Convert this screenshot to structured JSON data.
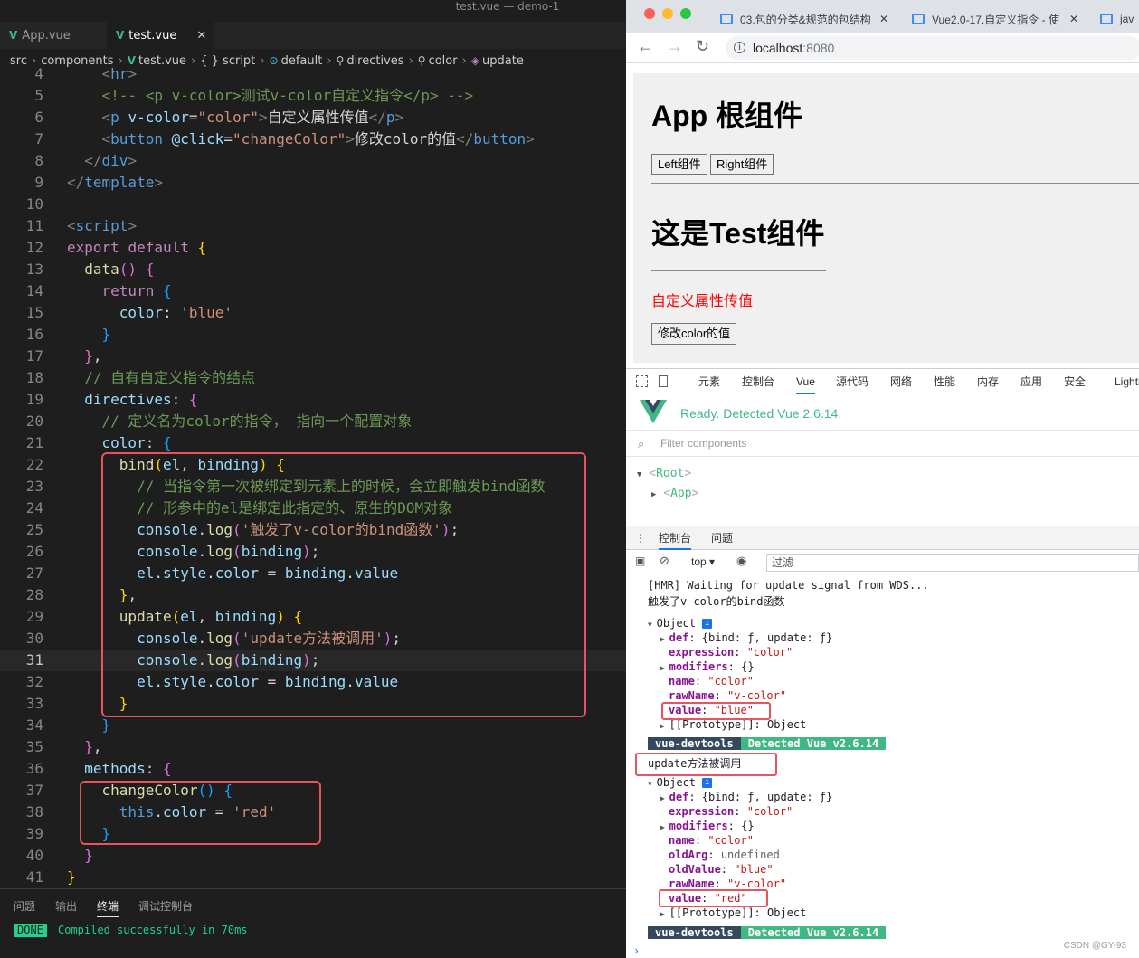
{
  "editor": {
    "window_title": "test.vue — demo-1",
    "tabs": [
      {
        "label": "App.vue",
        "active": false
      },
      {
        "label": "test.vue",
        "active": true
      }
    ],
    "breadcrumb": [
      "src",
      "components",
      "test.vue",
      "{ } script",
      "default",
      "directives",
      "color",
      "update"
    ],
    "current_line": 31,
    "lines": [
      {
        "n": 4,
        "segs": [
          [
            "g",
            "    <"
          ],
          [
            "k",
            "hr"
          ],
          [
            "g",
            ">"
          ]
        ]
      },
      {
        "n": 5,
        "segs": [
          [
            "c",
            "    <!-- <p v-color>测试v-color自定义指令</p> -->"
          ]
        ]
      },
      {
        "n": 6,
        "segs": [
          [
            "g",
            "    <"
          ],
          [
            "k",
            "p"
          ],
          [
            "w",
            " "
          ],
          [
            "a",
            "v-color"
          ],
          [
            "w",
            "="
          ],
          [
            "s",
            "\"color\""
          ],
          [
            "g",
            ">"
          ],
          [
            "w",
            "自定义属性传值"
          ],
          [
            "g",
            "</"
          ],
          [
            "k",
            "p"
          ],
          [
            "g",
            ">"
          ]
        ]
      },
      {
        "n": 7,
        "segs": [
          [
            "g",
            "    <"
          ],
          [
            "k",
            "button"
          ],
          [
            "w",
            " "
          ],
          [
            "a",
            "@click"
          ],
          [
            "w",
            "="
          ],
          [
            "s",
            "\"changeColor\""
          ],
          [
            "g",
            ">"
          ],
          [
            "w",
            "修改color的值"
          ],
          [
            "g",
            "</"
          ],
          [
            "k",
            "button"
          ],
          [
            "g",
            ">"
          ]
        ]
      },
      {
        "n": 8,
        "segs": [
          [
            "g",
            "  </"
          ],
          [
            "k",
            "div"
          ],
          [
            "g",
            ">"
          ]
        ]
      },
      {
        "n": 9,
        "segs": [
          [
            "g",
            "</"
          ],
          [
            "k",
            "template"
          ],
          [
            "g",
            ">"
          ]
        ]
      },
      {
        "n": 10,
        "segs": [
          [
            "w",
            ""
          ]
        ]
      },
      {
        "n": 11,
        "segs": [
          [
            "g",
            "<"
          ],
          [
            "k",
            "script"
          ],
          [
            "g",
            ">"
          ]
        ]
      },
      {
        "n": 12,
        "segs": [
          [
            "pk",
            "export"
          ],
          [
            "w",
            " "
          ],
          [
            "pk",
            "default"
          ],
          [
            "w",
            " "
          ],
          [
            "y",
            "{"
          ]
        ]
      },
      {
        "n": 13,
        "segs": [
          [
            "w",
            "  "
          ],
          [
            "f",
            "data"
          ],
          [
            "m",
            "()"
          ],
          [
            "w",
            " "
          ],
          [
            "m",
            "{"
          ]
        ]
      },
      {
        "n": 14,
        "segs": [
          [
            "w",
            "    "
          ],
          [
            "pk",
            "return"
          ],
          [
            "w",
            " "
          ],
          [
            "b",
            "{"
          ]
        ]
      },
      {
        "n": 15,
        "segs": [
          [
            "w",
            "      "
          ],
          [
            "a",
            "color"
          ],
          [
            "w",
            ": "
          ],
          [
            "s",
            "'blue'"
          ]
        ]
      },
      {
        "n": 16,
        "segs": [
          [
            "w",
            "    "
          ],
          [
            "b",
            "}"
          ]
        ]
      },
      {
        "n": 17,
        "segs": [
          [
            "w",
            "  "
          ],
          [
            "m",
            "}"
          ],
          [
            "w",
            ","
          ]
        ]
      },
      {
        "n": 18,
        "segs": [
          [
            "c",
            "  // 自有自定义指令的结点"
          ]
        ]
      },
      {
        "n": 19,
        "segs": [
          [
            "w",
            "  "
          ],
          [
            "a",
            "directives"
          ],
          [
            "w",
            ": "
          ],
          [
            "m",
            "{"
          ]
        ]
      },
      {
        "n": 20,
        "segs": [
          [
            "c",
            "    // 定义名为color的指令， 指向一个配置对象"
          ]
        ]
      },
      {
        "n": 21,
        "segs": [
          [
            "w",
            "    "
          ],
          [
            "a",
            "color"
          ],
          [
            "w",
            ": "
          ],
          [
            "b",
            "{"
          ]
        ]
      },
      {
        "n": 22,
        "segs": [
          [
            "w",
            "      "
          ],
          [
            "f",
            "bind"
          ],
          [
            "y",
            "("
          ],
          [
            "a",
            "el"
          ],
          [
            "w",
            ", "
          ],
          [
            "a",
            "binding"
          ],
          [
            "y",
            ")"
          ],
          [
            "w",
            " "
          ],
          [
            "y",
            "{"
          ]
        ]
      },
      {
        "n": 23,
        "segs": [
          [
            "c",
            "        // 当指令第一次被绑定到元素上的时候，会立即触发bind函数"
          ]
        ]
      },
      {
        "n": 24,
        "segs": [
          [
            "c",
            "        // 形参中的el是绑定此指定的、原生的DOM对象"
          ]
        ]
      },
      {
        "n": 25,
        "segs": [
          [
            "w",
            "        "
          ],
          [
            "a",
            "console"
          ],
          [
            "w",
            "."
          ],
          [
            "f",
            "log"
          ],
          [
            "m",
            "("
          ],
          [
            "s",
            "'触发了v-color的bind函数'"
          ],
          [
            "m",
            ")"
          ],
          [
            "w",
            ";"
          ]
        ]
      },
      {
        "n": 26,
        "segs": [
          [
            "w",
            "        "
          ],
          [
            "a",
            "console"
          ],
          [
            "w",
            "."
          ],
          [
            "f",
            "log"
          ],
          [
            "m",
            "("
          ],
          [
            "a",
            "binding"
          ],
          [
            "m",
            ")"
          ],
          [
            "w",
            ";"
          ]
        ]
      },
      {
        "n": 27,
        "segs": [
          [
            "w",
            "        "
          ],
          [
            "a",
            "el"
          ],
          [
            "w",
            "."
          ],
          [
            "a",
            "style"
          ],
          [
            "w",
            "."
          ],
          [
            "a",
            "color"
          ],
          [
            "w",
            " = "
          ],
          [
            "a",
            "binding"
          ],
          [
            "w",
            "."
          ],
          [
            "a",
            "value"
          ]
        ]
      },
      {
        "n": 28,
        "segs": [
          [
            "w",
            "      "
          ],
          [
            "y",
            "}"
          ],
          [
            "w",
            ","
          ]
        ]
      },
      {
        "n": 29,
        "segs": [
          [
            "w",
            "      "
          ],
          [
            "f",
            "update"
          ],
          [
            "y",
            "("
          ],
          [
            "a",
            "el"
          ],
          [
            "w",
            ", "
          ],
          [
            "a",
            "binding"
          ],
          [
            "y",
            ")"
          ],
          [
            "w",
            " "
          ],
          [
            "y",
            "{"
          ]
        ]
      },
      {
        "n": 30,
        "segs": [
          [
            "w",
            "        "
          ],
          [
            "a",
            "console"
          ],
          [
            "w",
            "."
          ],
          [
            "f",
            "log"
          ],
          [
            "m",
            "("
          ],
          [
            "s",
            "'update方法被调用'"
          ],
          [
            "m",
            ")"
          ],
          [
            "w",
            ";"
          ]
        ]
      },
      {
        "n": 31,
        "segs": [
          [
            "w",
            "        "
          ],
          [
            "a",
            "console"
          ],
          [
            "w",
            "."
          ],
          [
            "f",
            "log"
          ],
          [
            "m",
            "("
          ],
          [
            "a",
            "binding"
          ],
          [
            "m",
            ")"
          ],
          [
            "w",
            ";"
          ]
        ]
      },
      {
        "n": 32,
        "segs": [
          [
            "w",
            "        "
          ],
          [
            "a",
            "el"
          ],
          [
            "w",
            "."
          ],
          [
            "a",
            "style"
          ],
          [
            "w",
            "."
          ],
          [
            "a",
            "color"
          ],
          [
            "w",
            " = "
          ],
          [
            "a",
            "binding"
          ],
          [
            "w",
            "."
          ],
          [
            "a",
            "value"
          ]
        ]
      },
      {
        "n": 33,
        "segs": [
          [
            "w",
            "      "
          ],
          [
            "y",
            "}"
          ]
        ]
      },
      {
        "n": 34,
        "segs": [
          [
            "w",
            "    "
          ],
          [
            "b",
            "}"
          ]
        ]
      },
      {
        "n": 35,
        "segs": [
          [
            "w",
            "  "
          ],
          [
            "m",
            "}"
          ],
          [
            "w",
            ","
          ]
        ]
      },
      {
        "n": 36,
        "segs": [
          [
            "w",
            "  "
          ],
          [
            "a",
            "methods"
          ],
          [
            "w",
            ": "
          ],
          [
            "m",
            "{"
          ]
        ]
      },
      {
        "n": 37,
        "segs": [
          [
            "w",
            "    "
          ],
          [
            "f",
            "changeColor"
          ],
          [
            "b",
            "()"
          ],
          [
            "w",
            " "
          ],
          [
            "b",
            "{"
          ]
        ]
      },
      {
        "n": 38,
        "segs": [
          [
            "w",
            "      "
          ],
          [
            "k",
            "this"
          ],
          [
            "w",
            "."
          ],
          [
            "a",
            "color"
          ],
          [
            "w",
            " = "
          ],
          [
            "s",
            "'red'"
          ]
        ]
      },
      {
        "n": 39,
        "segs": [
          [
            "w",
            "    "
          ],
          [
            "b",
            "}"
          ]
        ]
      },
      {
        "n": 40,
        "segs": [
          [
            "w",
            "  "
          ],
          [
            "m",
            "}"
          ]
        ]
      },
      {
        "n": 41,
        "segs": [
          [
            "y",
            "}"
          ]
        ]
      }
    ],
    "panel": {
      "tabs": [
        "问题",
        "输出",
        "终端",
        "调试控制台"
      ],
      "active_tab": "终端",
      "done_label": "DONE",
      "done_message": "Compiled successfully in 70ms"
    }
  },
  "browser": {
    "tabs": [
      {
        "label": "03.包的分类&规范的包结构",
        "close": "✕"
      },
      {
        "label": "Vue2.0-17.自定义指令 - 使",
        "close": "✕"
      },
      {
        "label": "jav",
        "close": ""
      }
    ],
    "url": {
      "host": "localhost",
      "port": ":8080"
    },
    "page": {
      "app_title": "App 根组件",
      "buttons": [
        "Left组件",
        "Right组件"
      ],
      "test_title": "这是Test组件",
      "custom_text": "自定义属性传值",
      "custom_text_color": "#ff0000",
      "change_button": "修改color的值"
    },
    "devtools": {
      "tabs": [
        "元素",
        "控制台",
        "Vue",
        "源代码",
        "网络",
        "性能",
        "内存",
        "应用",
        "安全",
        "Lighthouse"
      ],
      "active_tab": "Vue",
      "vue_ready": "Ready. Detected Vue 2.6.14.",
      "filter_placeholder": "Filter components",
      "tree": [
        {
          "name": "Root",
          "expanded": true,
          "depth": 0
        },
        {
          "name": "App",
          "expanded": false,
          "depth": 1
        }
      ],
      "drawer_tabs": [
        "控制台",
        "问题"
      ],
      "context": "top",
      "filter_input": "过滤",
      "console_lines": [
        {
          "kind": "log",
          "text": "[HMR] Waiting for update signal from WDS..."
        },
        {
          "kind": "log",
          "text": "触发了v-color的bind函数"
        },
        {
          "kind": "object_header",
          "text": "Object"
        },
        {
          "kind": "prop",
          "key": "def",
          "value": "{bind: ƒ, update: ƒ}",
          "expandable": true
        },
        {
          "kind": "prop",
          "key": "expression",
          "value": "\"color\"",
          "string": true
        },
        {
          "kind": "prop",
          "key": "modifiers",
          "value": "{}",
          "expandable": true
        },
        {
          "kind": "prop",
          "key": "name",
          "value": "\"color\"",
          "string": true
        },
        {
          "kind": "prop",
          "key": "rawName",
          "value": "\"v-color\"",
          "string": true
        },
        {
          "kind": "prop",
          "key": "value",
          "value": "\"blue\"",
          "string": true
        },
        {
          "kind": "proto",
          "text": "[[Prototype]]: Object"
        },
        {
          "kind": "badge",
          "a": "vue-devtools",
          "b": "Detected Vue v2.6.14"
        },
        {
          "kind": "log",
          "text": "update方法被调用"
        },
        {
          "kind": "object_header",
          "text": "Object"
        },
        {
          "kind": "prop",
          "key": "def",
          "value": "{bind: ƒ, update: ƒ}",
          "expandable": true
        },
        {
          "kind": "prop",
          "key": "expression",
          "value": "\"color\"",
          "string": true
        },
        {
          "kind": "prop",
          "key": "modifiers",
          "value": "{}",
          "expandable": true
        },
        {
          "kind": "prop",
          "key": "name",
          "value": "\"color\"",
          "string": true
        },
        {
          "kind": "prop",
          "key": "oldArg",
          "value": "undefined",
          "undefined": true
        },
        {
          "kind": "prop",
          "key": "oldValue",
          "value": "\"blue\"",
          "string": true
        },
        {
          "kind": "prop",
          "key": "rawName",
          "value": "\"v-color\"",
          "string": true
        },
        {
          "kind": "prop",
          "key": "value",
          "value": "\"red\"",
          "string": true
        },
        {
          "kind": "proto",
          "text": "[[Prototype]]: Object"
        },
        {
          "kind": "badge",
          "a": "vue-devtools",
          "b": "Detected Vue v2.6.14"
        }
      ],
      "prompt": "›"
    },
    "credit": "CSDN @GY-93"
  }
}
